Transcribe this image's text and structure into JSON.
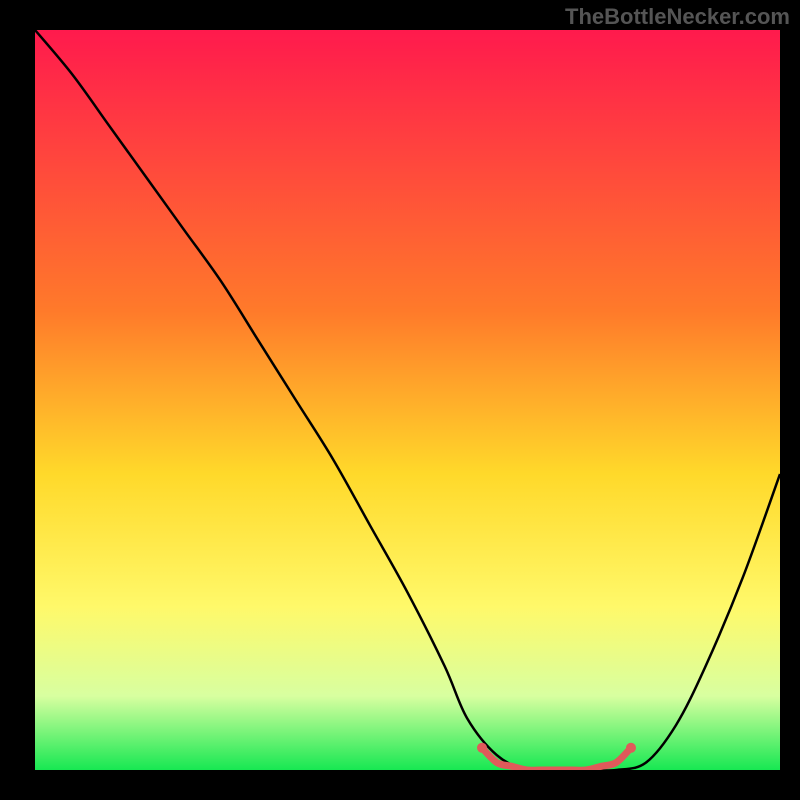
{
  "watermark": "TheBottleNecker.com",
  "chart_data": {
    "type": "line",
    "title": "",
    "xlabel": "",
    "ylabel": "",
    "xlim": [
      0,
      100
    ],
    "ylim": [
      0,
      100
    ],
    "gradient_stops": [
      {
        "offset": 0,
        "color": "#ff1a4d"
      },
      {
        "offset": 38,
        "color": "#ff7a2a"
      },
      {
        "offset": 60,
        "color": "#ffd92a"
      },
      {
        "offset": 78,
        "color": "#fff96a"
      },
      {
        "offset": 90,
        "color": "#d8ffa0"
      },
      {
        "offset": 100,
        "color": "#17e852"
      }
    ],
    "series": [
      {
        "name": "bottleneck-curve",
        "color": "#000000",
        "x": [
          0,
          5,
          10,
          15,
          20,
          25,
          30,
          35,
          40,
          45,
          50,
          55,
          58,
          62,
          66,
          70,
          74,
          78,
          82,
          86,
          90,
          95,
          100
        ],
        "y": [
          100,
          94,
          87,
          80,
          73,
          66,
          58,
          50,
          42,
          33,
          24,
          14,
          7,
          2,
          0,
          0,
          0,
          0,
          1,
          6,
          14,
          26,
          40
        ]
      },
      {
        "name": "sweet-spot-marker",
        "color": "#e05a5a",
        "x": [
          60,
          62,
          64,
          66,
          68,
          70,
          72,
          74,
          76,
          78,
          80
        ],
        "y": [
          3,
          1,
          0.5,
          0,
          0,
          0,
          0,
          0,
          0.5,
          1,
          3
        ]
      }
    ]
  }
}
